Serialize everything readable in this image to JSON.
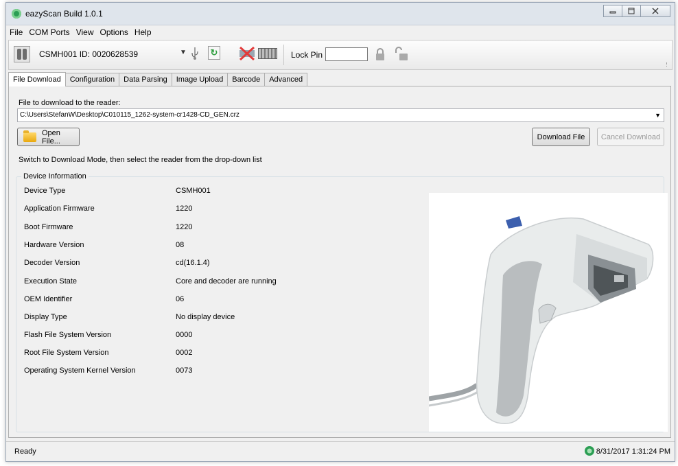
{
  "window": {
    "title": "eazyScan Build 1.0.1",
    "controls": [
      "minimize",
      "maximize",
      "close"
    ]
  },
  "menu": [
    "File",
    "COM Ports",
    "View",
    "Options",
    "Help"
  ],
  "toolbar": {
    "device": "CSMH001 ID: 0020628539",
    "lock_pin_label": "Lock Pin",
    "lock_pin_value": ""
  },
  "tabs": [
    "File Download",
    "Configuration",
    "Data Parsing",
    "Image Upload",
    "Barcode",
    "Advanced"
  ],
  "active_tab": "File Download",
  "file_download": {
    "file_label": "File to download to the reader:",
    "file_path": "C:\\Users\\StefanW\\Desktop\\C010115_1262-system-cr1428-CD_GEN.crz",
    "open_button": "Open File...",
    "download_button": "Download File",
    "cancel_button": "Cancel Download",
    "hint": "Switch to Download Mode, then select the reader from the drop-down list"
  },
  "device_info": {
    "title": "Device Information",
    "rows": [
      {
        "label": "Device Type",
        "value": "CSMH001"
      },
      {
        "label": "Application Firmware",
        "value": "1220"
      },
      {
        "label": "Boot Firmware",
        "value": "1220"
      },
      {
        "label": "Hardware Version",
        "value": "08"
      },
      {
        "label": "Decoder Version",
        "value": "cd(16.1.4)"
      },
      {
        "label": "Execution State",
        "value": "Core and decoder are running"
      },
      {
        "label": "OEM Identifier",
        "value": "06"
      },
      {
        "label": "Display Type",
        "value": "No display device"
      },
      {
        "label": "Flash File System Version",
        "value": "0000"
      },
      {
        "label": "Root File System Version",
        "value": "0002"
      },
      {
        "label": "Operating System Kernel Version",
        "value": "0073"
      }
    ]
  },
  "status": {
    "text": "Ready",
    "datetime": "8/31/2017 1:31:24 PM"
  },
  "colors": {
    "accent_green": "#2c9e54",
    "scanner_body": "#e9ecec",
    "scanner_grip": "#b9bdbf"
  }
}
